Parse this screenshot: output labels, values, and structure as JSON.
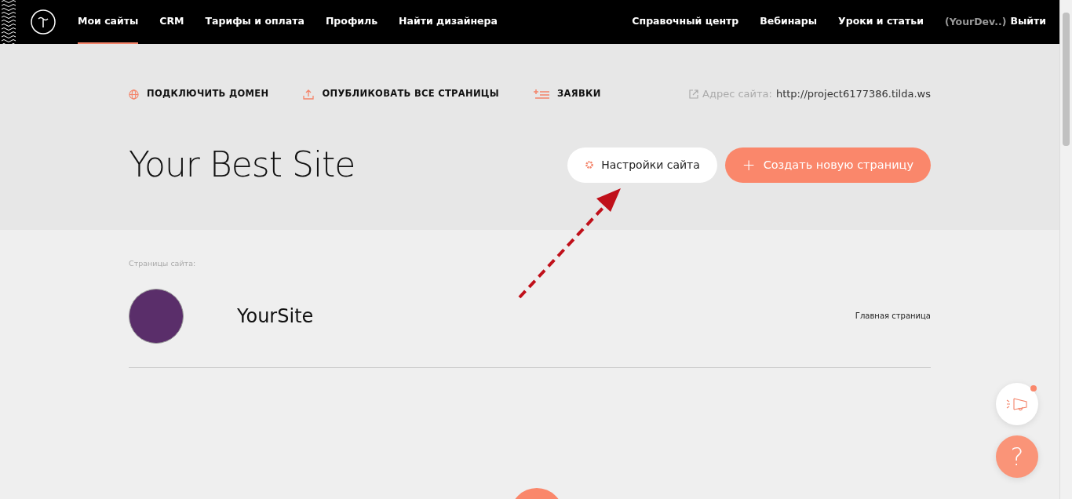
{
  "nav": {
    "items": [
      {
        "label": "Мои сайты",
        "selected": true
      },
      {
        "label": "CRM",
        "selected": false
      },
      {
        "label": "Тарифы и оплата",
        "selected": false
      },
      {
        "label": "Профиль",
        "selected": false
      },
      {
        "label": "Найти дизайнера",
        "selected": false
      }
    ],
    "right_items": [
      "Справочный центр",
      "Вебинары",
      "Уроки и статьи"
    ],
    "user": "(YourDev..)",
    "logout": "Выйти"
  },
  "toolbar": {
    "actions": [
      {
        "kind": "globe",
        "label": "ПОДКЛЮЧИТЬ ДОМЕН"
      },
      {
        "kind": "upload",
        "label": "ОПУБЛИКОВАТЬ ВСЕ СТРАНИЦЫ"
      },
      {
        "kind": "list",
        "label": "ЗАЯВКИ"
      }
    ],
    "address_label": "Адрес сайта:",
    "address": "http://project6177386.tilda.ws"
  },
  "site": {
    "title": "Your Best Site",
    "settings_button": "Настройки сайта",
    "create_button": "Создать новую страницу",
    "create_icon": "+"
  },
  "pages": {
    "heading": "Страницы сайта:",
    "items": [
      {
        "title": "YourSite",
        "tag": "Главная страница"
      }
    ]
  },
  "help_button": "?"
}
